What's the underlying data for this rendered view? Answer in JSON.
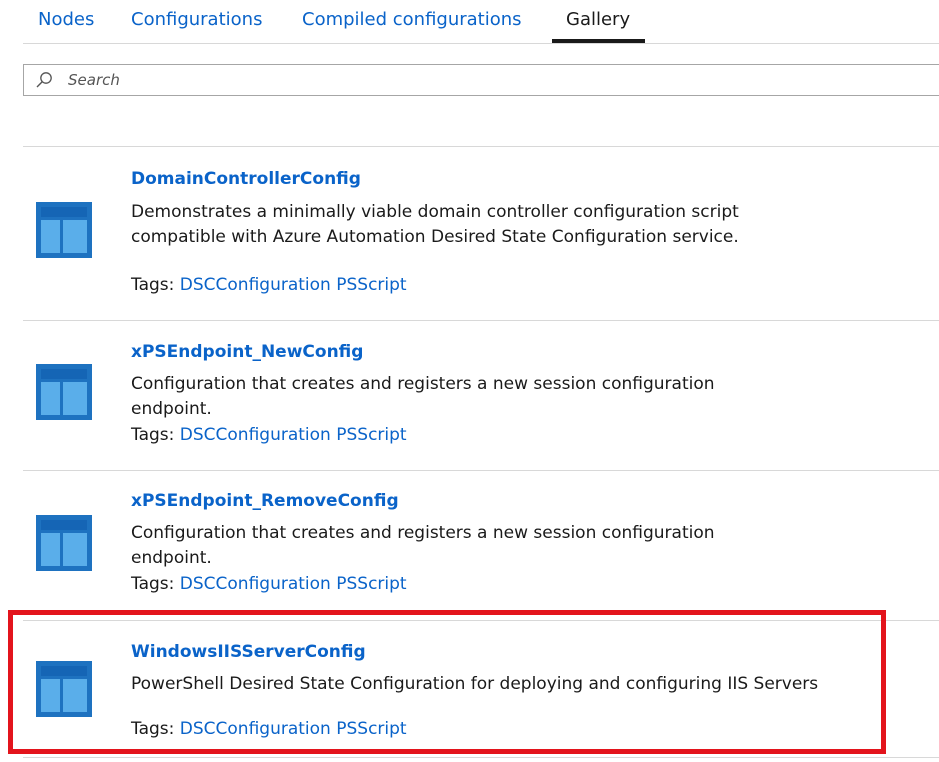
{
  "tabs": [
    {
      "label": "Nodes",
      "active": false
    },
    {
      "label": "Configurations",
      "active": false
    },
    {
      "label": "Compiled configurations",
      "active": false
    },
    {
      "label": "Gallery",
      "active": true
    }
  ],
  "search": {
    "placeholder": "Search",
    "value": ""
  },
  "gallery": {
    "items": [
      {
        "title": "DomainControllerConfig",
        "description": "Demonstrates a minimally viable domain controller configuration script compatible with Azure Automation Desired State Configuration service.",
        "tags_label": "Tags:",
        "tags": [
          "DSCConfiguration",
          "PSScript"
        ],
        "icon": "configuration-icon"
      },
      {
        "title": "xPSEndpoint_NewConfig",
        "description": "Configuration that creates and registers a new session configuration endpoint.",
        "tags_label": "Tags:",
        "tags": [
          "DSCConfiguration",
          "PSScript"
        ],
        "icon": "configuration-icon"
      },
      {
        "title": "xPSEndpoint_RemoveConfig",
        "description": "Configuration that creates and registers a new session configuration endpoint.",
        "tags_label": "Tags:",
        "tags": [
          "DSCConfiguration",
          "PSScript"
        ],
        "icon": "configuration-icon"
      },
      {
        "title": "WindowsIISServerConfig",
        "description": "PowerShell Desired State Configuration for deploying and configuring IIS Servers",
        "tags_label": "Tags:",
        "tags": [
          "DSCConfiguration",
          "PSScript"
        ],
        "icon": "configuration-icon",
        "highlighted": true
      }
    ]
  },
  "colors": {
    "link": "#0a63c9",
    "highlight": "#e3141c",
    "icon_dark": "#1e72c0",
    "icon_light": "#4da8e8"
  }
}
